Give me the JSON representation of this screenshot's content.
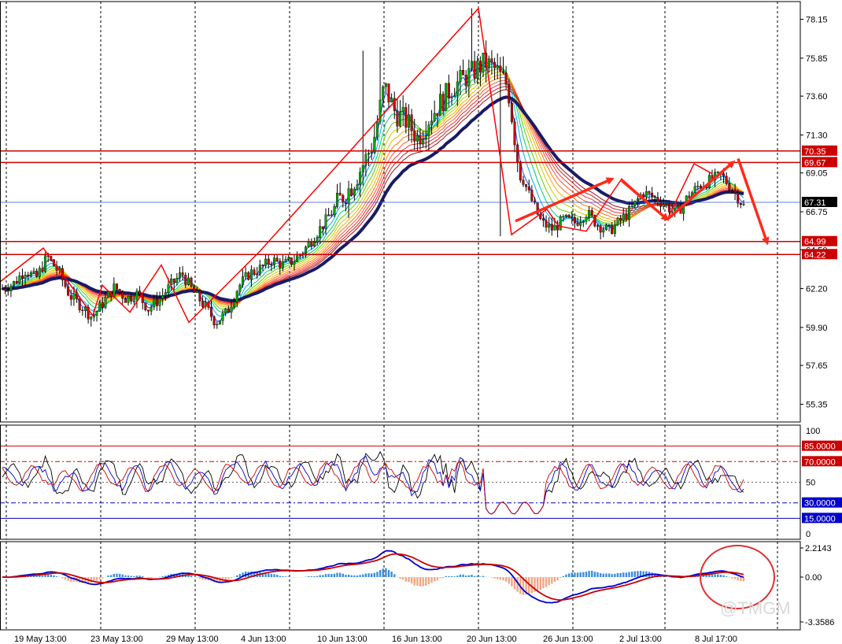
{
  "chart_data": {
    "type": "candlestick",
    "x_labels": [
      "19 May 13:00",
      "23 May 13:00",
      "29 May 13:00",
      "4 Jun 13:00",
      "10 Jun 13:00",
      "16 Jun 13:00",
      "20 Jun 13:00",
      "26 Jun 13:00",
      "2 Jul 13:00",
      "8 Jul 17:00"
    ],
    "price": {
      "y_ticks": [
        "78.15",
        "75.85",
        "73.60",
        "71.30",
        "69.05",
        "66.75",
        "64.50",
        "62.20",
        "59.90",
        "57.65",
        "55.35"
      ],
      "ylim": [
        54.3,
        79.2
      ],
      "current_price": "67.31",
      "levels": [
        {
          "label": "70.35",
          "value": 70.35
        },
        {
          "label": "69.67",
          "value": 69.67
        },
        {
          "label": "64.99",
          "value": 64.99
        },
        {
          "label": "64.22",
          "value": 64.22
        }
      ],
      "close_path": [
        62.2,
        62.5,
        63.3,
        62.8,
        64.1,
        63.2,
        61.8,
        61.2,
        60.5,
        61.4,
        62.3,
        61.6,
        61.9,
        61.0,
        61.6,
        62.4,
        63.1,
        62.0,
        61.2,
        60.2,
        60.8,
        62.3,
        63.1,
        63.4,
        63.9,
        63.6,
        63.9,
        64.6,
        65.5,
        66.4,
        67.4,
        68.2,
        69.4,
        70.8,
        74.2,
        72.6,
        72.1,
        71.1,
        72.3,
        73.2,
        74.1,
        74.6,
        75.1,
        75.6,
        75.1,
        74.2,
        69.3,
        67.6,
        66.1,
        65.7,
        66.3,
        66.1,
        66.7,
        66.0,
        65.6,
        66.2,
        66.9,
        67.9,
        67.6,
        67.2,
        66.6,
        67.6,
        68.3,
        68.6,
        68.9,
        68.1,
        67.1
      ],
      "colors": {
        "bull": "#00aa00",
        "bear": "#cc0000",
        "ma_slow": "#1a1a66",
        "zigzag": "#ff0000",
        "level": "#cc0000",
        "price_line": "#3355cc",
        "arrow": "#ff2a1a"
      }
    },
    "rsi": {
      "y_ticks": [
        "100",
        "85.0000",
        "70.0000",
        "50",
        "30.0000",
        "15.0000",
        "0"
      ],
      "ylim": [
        0,
        100
      ],
      "levels": [
        85,
        70,
        50,
        30,
        15
      ]
    },
    "macd": {
      "y_ticks": [
        "2.2143",
        "0.00",
        "-3.3586"
      ],
      "ylim": [
        -3.3586,
        2.2143
      ]
    }
  },
  "watermark": "@TMGM"
}
